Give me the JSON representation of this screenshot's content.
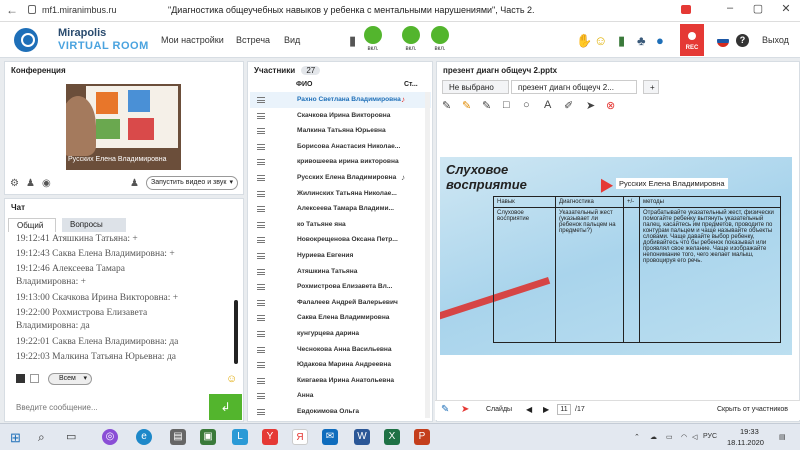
{
  "browser": {
    "url": "mf1.miranimbus.ru",
    "title": "\"Диагностика общеучебных навыков у ребенка с ментальными нарушениями\", Часть 2."
  },
  "app": {
    "brand_line1": "Mirapolis",
    "brand_line2": "VIRTUAL ROOM",
    "menu": [
      "Мои настройки",
      "Встреча",
      "Вид"
    ],
    "mic_label": "вкл.",
    "cam_label": "вкл.",
    "screen_label": "вкл.",
    "rec_label": "REC",
    "exit_label": "Выход",
    "help_label": "?"
  },
  "conference": {
    "title": "Конференция",
    "presenter_name": "Русских Елена Владимировна",
    "start_button": "Запустить видео и звук"
  },
  "chat": {
    "title": "Чат",
    "tabs": [
      "Общий",
      "Вопросы"
    ],
    "messages": [
      {
        "text": "19:12:41 Атяшкина Татьяна: +"
      },
      {
        "text": "19:12:43 Саква Елена Владимировна: +"
      },
      {
        "text": "19:12:46 Алексеева   Тамара"
      },
      {
        "text": "Владимировна: +"
      },
      {
        "text": "19:13:00 Скачкова  Ирина Викторовна: +"
      },
      {
        "text": "19:22:00 Рохмистрова  Елизавета"
      },
      {
        "text": "Владимировна: да"
      },
      {
        "text": "19:22:01 Саква Елена Владимировна: да"
      },
      {
        "text": "19:22:03 Малкина Татьяна  Юрьевна: да"
      }
    ],
    "recipient": "Всем",
    "input_placeholder": "Введите сообщение..."
  },
  "participants": {
    "title": "Участники",
    "count": "27",
    "col_name": "ФИО",
    "col_status": "Ст...",
    "list": [
      "Рахно Светлана  Владимировна",
      "Скачкова  Ирина Викторовна",
      "Малкина Татьяна  Юрьевна",
      "Борисова  Анастасия Николае...",
      "кривошеева ирина викторовна",
      "Русских Елена Владимировна",
      "Жилинских  Татьяна  Николае...",
      "Алексеева  Тамара  Владими...",
      "ко Татьяне яна",
      "Новокрещенова  Оксана Петр...",
      "Нуриева Евгения",
      "Атяшкина Татьяна",
      "Рохмистрова  Елизавета Вл...",
      "Фалалеев  Андрей  Валерьевич",
      "Саква Елена Владимировна",
      "кунгурцева   дарина",
      "Чеснокова  Анна Васильевна",
      "Юдакова  Марина  Андреевна",
      "Кивгаева  Ирина  Анатольевна",
      "Анна",
      "Евдокимова Ольга"
    ]
  },
  "presentation": {
    "title": "презент диагн общеуч 2.pptx",
    "tabs": [
      "Не выбрано",
      "презент диагн общеуч 2...",
      "+"
    ],
    "slide_title_1": "Слуховое",
    "slide_title_2": "восприятие",
    "pointer_name": "Русских Елена Владимировна",
    "table_headers": [
      "Навык",
      "Диагностика",
      "+/-",
      "методы"
    ],
    "row_skill": "Слуховое восприятие",
    "row_diag": "Указательный жест (указывает ли ребенок пальцем на предметы?)",
    "row_methods": "Отрабатывайте указательный жест, физически помогайте ребенку вытянуть указательный палец, касайтесь им предметов, проводите по контурам пальцем и чаще называйте объекты словами. Чаще давайте выбор ребенку, добивайтесь что бы ребенок показывал или проявлял свое желание. Чаще изображайте непонимание того, чего желает малыш, провоцируя его речь.",
    "slides_label": "Слайды",
    "page_current": "11",
    "page_total": "/17",
    "hide_label": "Скрыть от участников"
  },
  "taskbar": {
    "lang": "РУС",
    "time": "19:33",
    "date": "18.11.2020"
  }
}
